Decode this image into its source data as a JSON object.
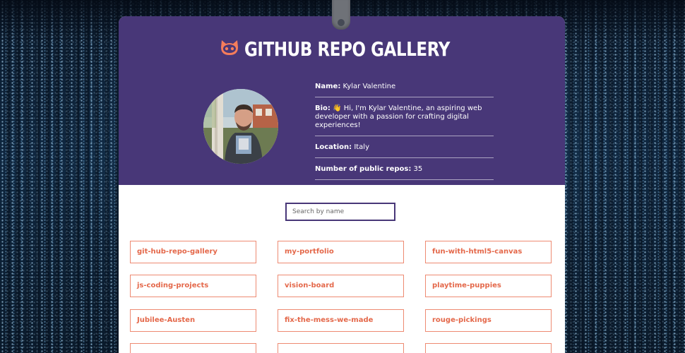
{
  "header": {
    "title": "GITHUB REPO GALLERY",
    "logo_icon": "octocat-icon"
  },
  "profile": {
    "name_label": "Name:",
    "name": "Kylar Valentine",
    "bio_label": "Bio:",
    "bio": "👋 Hi, I'm Kylar Valentine, an aspiring web developer with a passion for crafting digital experiences!",
    "location_label": "Location:",
    "location": "Italy",
    "repos_label": "Number of public repos:",
    "repos_count": "35"
  },
  "search": {
    "placeholder": "Search by name"
  },
  "repos": [
    "git-hub-repo-gallery",
    "my-portfolio",
    "fun-with-html5-canvas",
    "js-coding-projects",
    "vision-board",
    "playtime-puppies",
    "Jubilee-Austen",
    "fix-the-mess-we-made",
    "rouge-pickings"
  ],
  "colors": {
    "header_bg": "#483778",
    "accent": "#e4684a",
    "repo_border": "#ee8a72"
  }
}
